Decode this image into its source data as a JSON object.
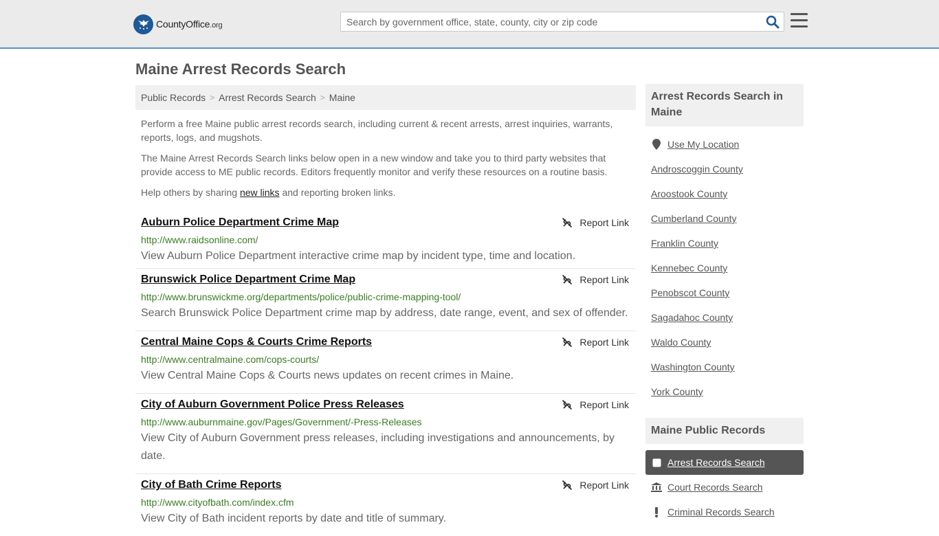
{
  "header": {
    "logo_name": "CountyOffice",
    "logo_tld": ".org",
    "search_placeholder": "Search by government office, state, county, city or zip code"
  },
  "page": {
    "title": "Maine Arrest Records Search"
  },
  "breadcrumb": [
    "Public Records",
    "Arrest Records Search",
    "Maine"
  ],
  "intro": {
    "p1": "Perform a free Maine public arrest records search, including current & recent arrests, arrest inquiries, warrants, reports, logs, and mugshots.",
    "p2": "The Maine Arrest Records Search links below open in a new window and take you to third party websites that provide access to ME public records. Editors frequently monitor and verify these resources on a routine basis.",
    "p3_before": "Help others by sharing ",
    "p3_link": "new links",
    "p3_after": " and reporting broken links."
  },
  "report_label": "Report Link",
  "results": [
    {
      "title": "Auburn Police Department Crime Map",
      "url": "http://www.raidsonline.com/",
      "desc": "View Auburn Police Department interactive crime map by incident type, time and location."
    },
    {
      "title": "Brunswick Police Department Crime Map",
      "url": "http://www.brunswickme.org/departments/police/public-crime-mapping-tool/",
      "desc": "Search Brunswick Police Department crime map by address, date range, event, and sex of offender."
    },
    {
      "title": "Central Maine Cops & Courts Crime Reports",
      "url": "http://www.centralmaine.com/cops-courts/",
      "desc": "View Central Maine Cops & Courts news updates on recent crimes in Maine."
    },
    {
      "title": "City of Auburn Government Police Press Releases",
      "url": "http://www.auburnmaine.gov/Pages/Government/-Press-Releases",
      "desc": "View City of Auburn Government press releases, including investigations and announcements, by date."
    },
    {
      "title": "City of Bath Crime Reports",
      "url": "http://www.cityofbath.com/index.cfm",
      "desc": "View City of Bath incident reports by date and title of summary."
    }
  ],
  "sidebar": {
    "counties_heading": "Arrest Records Search in Maine",
    "use_location": "Use My Location",
    "counties": [
      "Androscoggin County",
      "Aroostook County",
      "Cumberland County",
      "Franklin County",
      "Kennebec County",
      "Penobscot County",
      "Sagadahoc County",
      "Waldo County",
      "Washington County",
      "York County"
    ],
    "records_heading": "Maine Public Records",
    "records": [
      {
        "label": "Arrest Records Search",
        "icon": "square-icon"
      },
      {
        "label": "Court Records Search",
        "icon": "courthouse-icon"
      },
      {
        "label": "Criminal Records Search",
        "icon": "exclamation-icon"
      }
    ]
  }
}
